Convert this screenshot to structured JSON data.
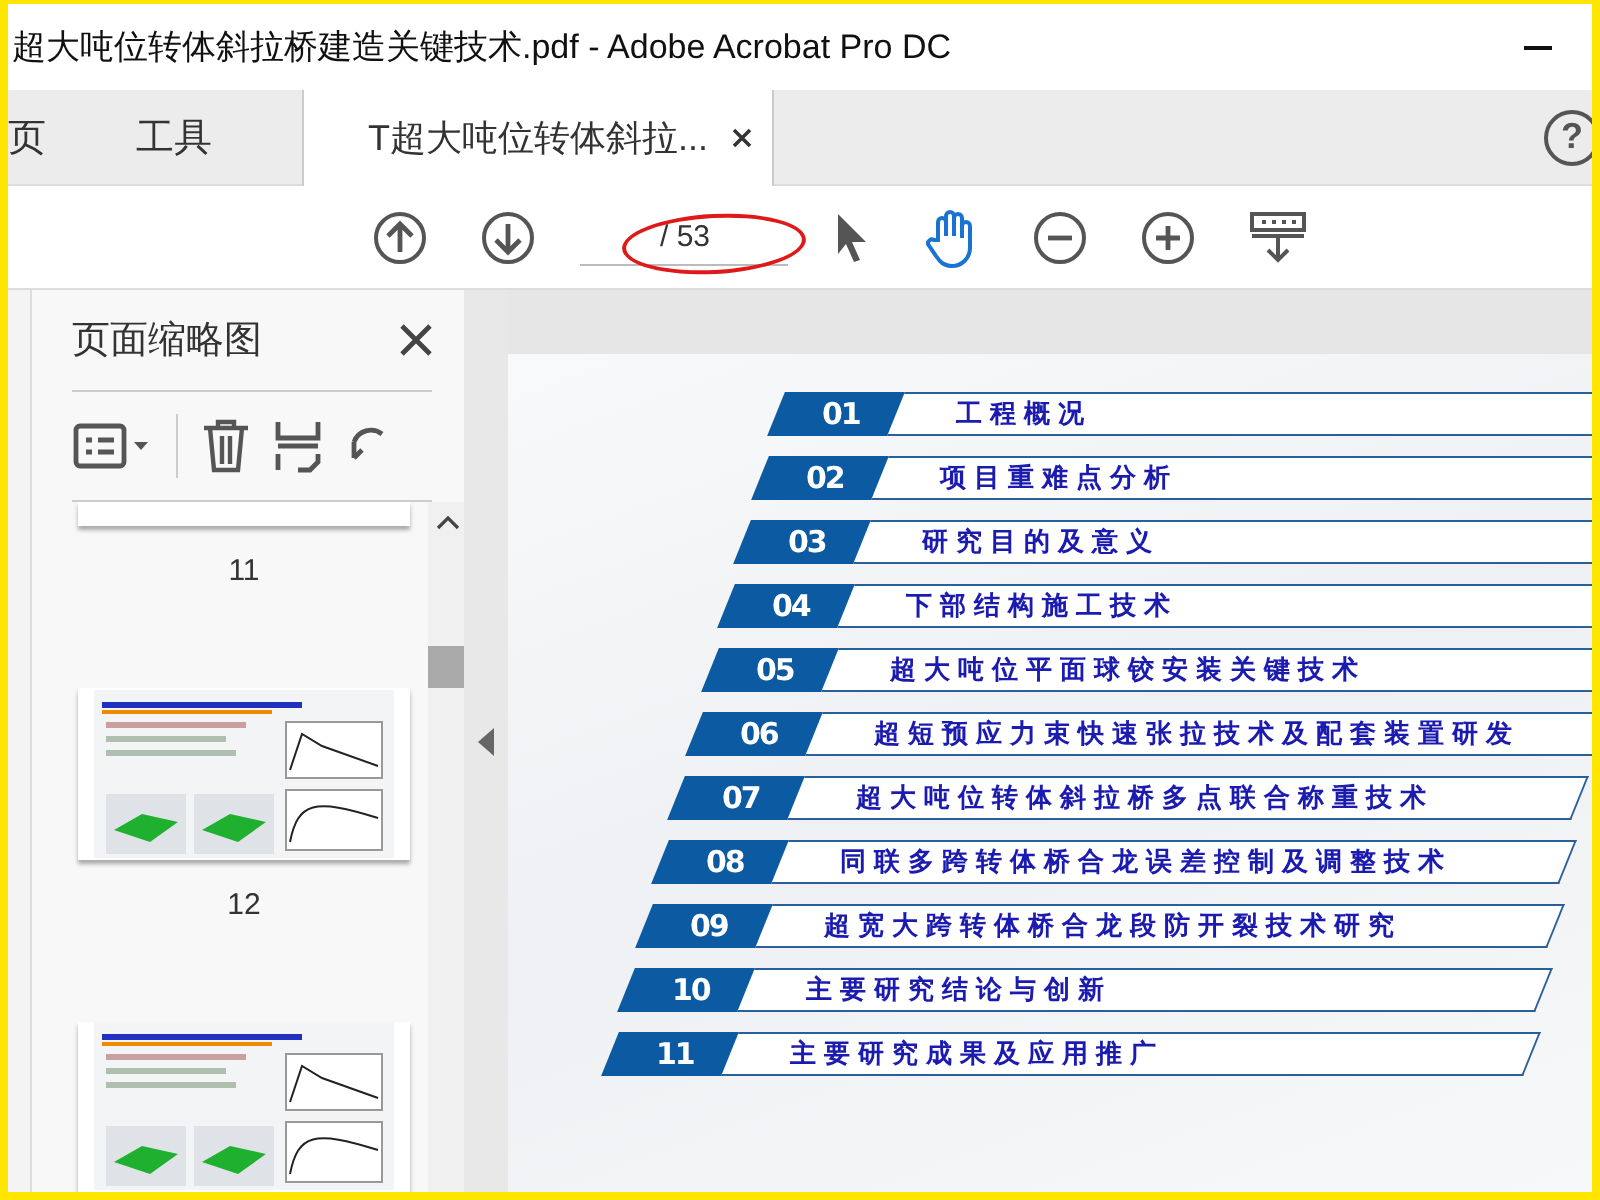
{
  "window": {
    "title": "超大吨位转体斜拉桥建造关键技术.pdf - Adobe Acrobat Pro DC"
  },
  "tabs": [
    {
      "label": "页",
      "selected": false,
      "closable": false
    },
    {
      "label": "工具",
      "selected": false,
      "closable": false
    },
    {
      "label": "T超大吨位转体斜拉...",
      "selected": true,
      "closable": true
    }
  ],
  "help": "?",
  "toolbar": {
    "page_total": "/ 53",
    "tools": [
      {
        "kind": "prev",
        "selected": false
      },
      {
        "kind": "next",
        "selected": false
      },
      {
        "kind": "page"
      },
      {
        "kind": "select",
        "selected": false
      },
      {
        "kind": "hand",
        "selected": true
      },
      {
        "kind": "zoom_out",
        "selected": false
      },
      {
        "kind": "zoom_in",
        "selected": false
      },
      {
        "kind": "keyboard",
        "selected": false
      }
    ]
  },
  "panel": {
    "title": "页面缩略图",
    "thumbnails": [
      {
        "kind": "blank",
        "label": "11"
      },
      {
        "kind": "picture",
        "label": "12"
      },
      {
        "kind": "picture"
      }
    ]
  },
  "slide": {
    "items": [
      {
        "number": "01",
        "text": "工程概况"
      },
      {
        "number": "02",
        "text": "项目重难点分析"
      },
      {
        "number": "03",
        "text": "研究目的及意义"
      },
      {
        "number": "04",
        "text": "下部结构施工技术"
      },
      {
        "number": "05",
        "text": "超大吨位平面球铰安装关键技术"
      },
      {
        "number": "06",
        "text": "超短预应力束快速张拉技术及配套装置研发"
      },
      {
        "number": "07",
        "text": "超大吨位转体斜拉桥多点联合称重技术"
      },
      {
        "number": "08",
        "text": "同联多跨转体桥合龙误差控制及调整技术"
      },
      {
        "number": "09",
        "text": "超宽大跨转体桥合龙段防开裂技术研究"
      },
      {
        "number": "10",
        "text": "主要研究结论与创新"
      },
      {
        "number": "11",
        "text": "主要研究成果及应用推广"
      }
    ]
  }
}
